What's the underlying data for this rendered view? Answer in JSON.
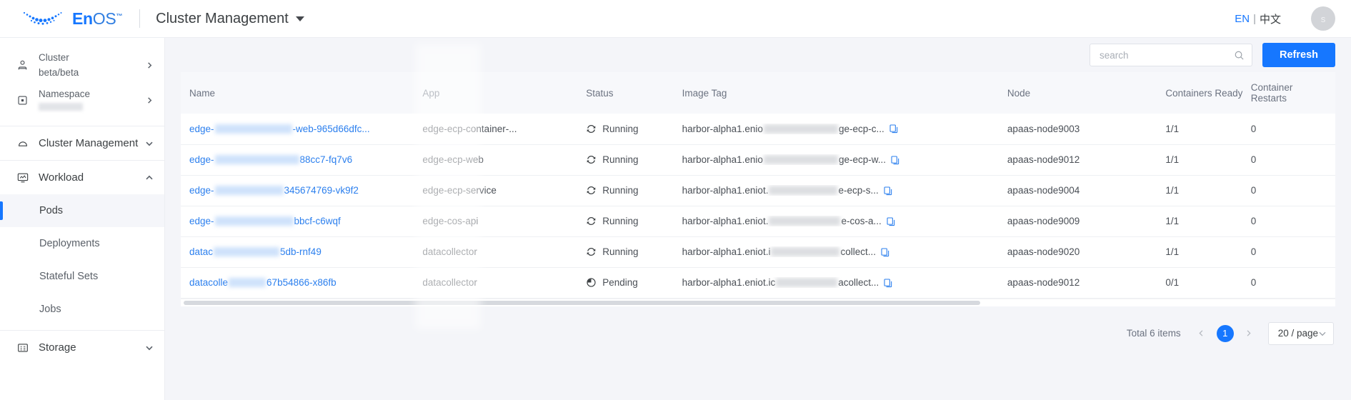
{
  "header": {
    "brand_name": "EnOS",
    "brand_tm": "™",
    "page_title": "Cluster Management",
    "lang_en": "EN",
    "lang_sep": "|",
    "lang_zh": "中文",
    "avatar_initial": "s",
    "accent_color": "#1677ff"
  },
  "sidebar": {
    "context": [
      {
        "label": "Cluster",
        "value": "beta/beta",
        "icon": "user-icon",
        "redacted": false
      },
      {
        "label": "Namespace",
        "value": "",
        "icon": "namespace-icon",
        "redacted": true
      }
    ],
    "groups": [
      {
        "label": "Cluster Management",
        "icon": "cloud-icon",
        "expanded": false,
        "items": []
      },
      {
        "label": "Workload",
        "icon": "workload-icon",
        "expanded": true,
        "items": [
          {
            "label": "Pods",
            "active": true
          },
          {
            "label": "Deployments",
            "active": false
          },
          {
            "label": "Stateful Sets",
            "active": false
          },
          {
            "label": "Jobs",
            "active": false
          }
        ]
      },
      {
        "label": "Storage",
        "icon": "storage-icon",
        "expanded": false,
        "items": []
      }
    ]
  },
  "toolbar": {
    "search_value": "",
    "search_placeholder": "search",
    "refresh_label": "Refresh"
  },
  "table": {
    "columns": [
      {
        "key": "name",
        "label": "Name"
      },
      {
        "key": "app",
        "label": "App"
      },
      {
        "key": "status",
        "label": "Status"
      },
      {
        "key": "image_tag",
        "label": "Image Tag"
      },
      {
        "key": "node",
        "label": "Node"
      },
      {
        "key": "containers_ready",
        "label": "Containers Ready"
      },
      {
        "key": "container_restarts",
        "label": "Container Restarts"
      }
    ],
    "rows": [
      {
        "name_prefix": "edge-",
        "name_suffix": "-web-965d66dfc...",
        "app": "edge-ecp-container-...",
        "status": "Running",
        "status_icon": "sync-icon",
        "tag_prefix": "harbor-alpha1.enio",
        "tag_suffix": "ge-ecp-c...",
        "node": "apaas-node9003",
        "containers_ready": "1/1",
        "container_restarts": "0"
      },
      {
        "name_prefix": "edge-",
        "name_suffix": "88cc7-fq7v6",
        "app": "edge-ecp-web",
        "status": "Running",
        "status_icon": "sync-icon",
        "tag_prefix": "harbor-alpha1.enio",
        "tag_suffix": "ge-ecp-w...",
        "node": "apaas-node9012",
        "containers_ready": "1/1",
        "container_restarts": "0"
      },
      {
        "name_prefix": "edge-",
        "name_suffix": "345674769-vk9f2",
        "app": "edge-ecp-service",
        "status": "Running",
        "status_icon": "sync-icon",
        "tag_prefix": "harbor-alpha1.eniot.",
        "tag_suffix": "e-ecp-s...",
        "node": "apaas-node9004",
        "containers_ready": "1/1",
        "container_restarts": "0"
      },
      {
        "name_prefix": "edge-",
        "name_suffix": "bbcf-c6wqf",
        "app": "edge-cos-api",
        "status": "Running",
        "status_icon": "sync-icon",
        "tag_prefix": "harbor-alpha1.eniot.",
        "tag_suffix": "e-cos-a...",
        "node": "apaas-node9009",
        "containers_ready": "1/1",
        "container_restarts": "0"
      },
      {
        "name_prefix": "datac",
        "name_suffix": "5db-rnf49",
        "app": "datacollector",
        "status": "Running",
        "status_icon": "sync-icon",
        "tag_prefix": "harbor-alpha1.eniot.i",
        "tag_suffix": "collect...",
        "node": "apaas-node9020",
        "containers_ready": "1/1",
        "container_restarts": "0"
      },
      {
        "name_prefix": "datacolle",
        "name_suffix": "67b54866-x86fb",
        "app": "datacollector",
        "status": "Pending",
        "status_icon": "clock-icon",
        "tag_prefix": "harbor-alpha1.eniot.ic",
        "tag_suffix": "acollect...",
        "node": "apaas-node9012",
        "containers_ready": "0/1",
        "container_restarts": "0"
      }
    ]
  },
  "pagination": {
    "total_label": "Total 6 items",
    "prev_label": "‹",
    "current_page": "1",
    "next_label": "›",
    "page_size_label": "20 / page"
  }
}
